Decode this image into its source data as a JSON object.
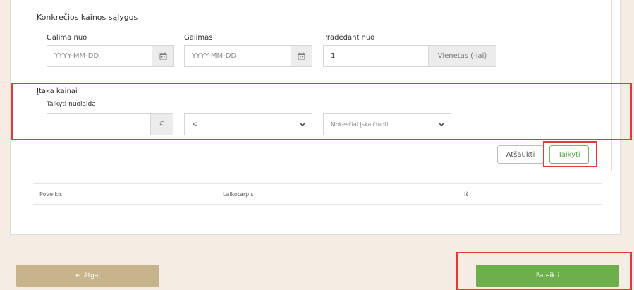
{
  "section": {
    "title": "Konkrečios kainos sąlygos",
    "available_from_label": "Galima nuo",
    "available_from_placeholder": "YYYY-MM-DD",
    "available_to_label": "Galimas",
    "available_to_placeholder": "YYYY-MM-DD",
    "starting_from_label": "Pradedant nuo",
    "starting_from_value": "1",
    "starting_from_unit": "Vienetas (-iai)"
  },
  "impact": {
    "title": "Įtaka kainai",
    "discount_label": "Taikyti nuolaidą",
    "currency_symbol": "€",
    "operator_value": "<",
    "tax_value": "Mokesčiai įskaičiuoti"
  },
  "actions": {
    "cancel_label": "Atšaukti",
    "apply_label": "Taikyti"
  },
  "table": {
    "columns": [
      "Poveikis",
      "Laikotarpis",
      "Iš"
    ]
  },
  "footer": {
    "back_label": "Atgal",
    "back_arrow": "←",
    "submit_label": "Pateikti"
  },
  "colors": {
    "accent_green": "#6db04b",
    "back_button": "#c8b48c",
    "highlight_red": "#e53935"
  }
}
